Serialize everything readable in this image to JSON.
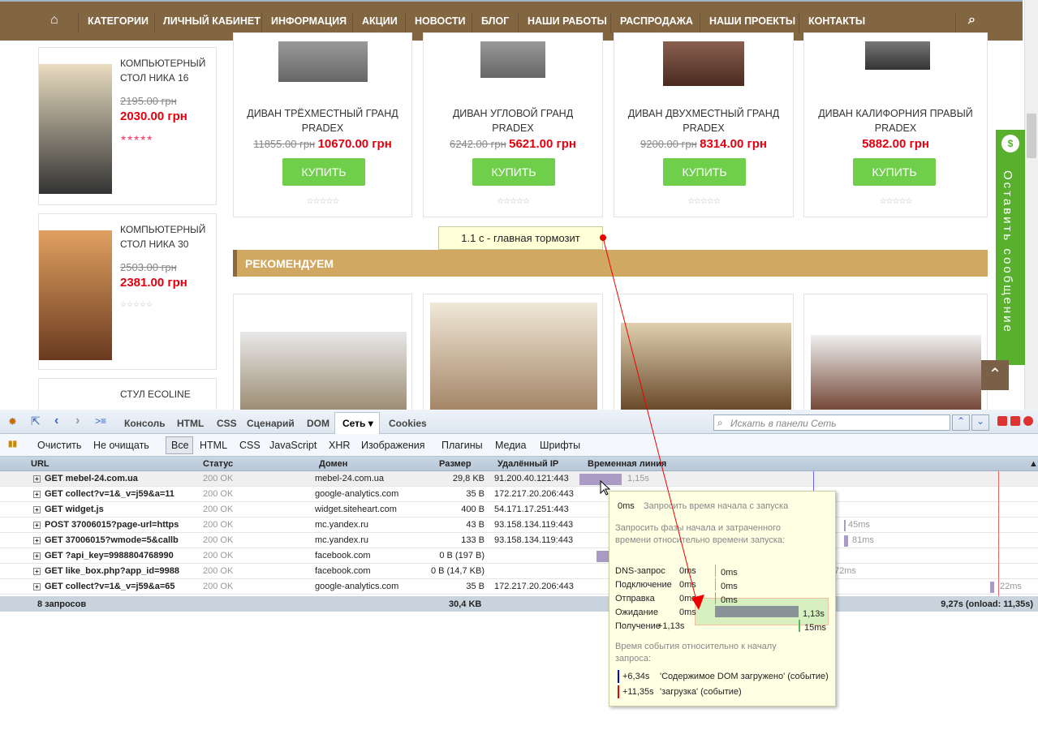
{
  "nav": {
    "items": [
      "Категории",
      "Личный кабинет",
      "Информация",
      "Акции",
      "Новости",
      "Блог",
      "Наши работы",
      "Распродажа",
      "Наши проекты",
      "Контакты"
    ]
  },
  "sidebar": [
    {
      "title": "Компьютерный стол Ника 16",
      "old": "2195.00 грн",
      "new": "2030.00 грн",
      "stars": "★★★★★"
    },
    {
      "title": "Компьютерный стол Ника 30",
      "old": "2503.00 грн",
      "new": "2381.00 грн",
      "stars": "☆☆☆☆☆"
    },
    {
      "title": "Стул Ecoline"
    }
  ],
  "products": [
    {
      "name": "ДИВАН ТРЁХМЕСТНЫЙ ГРАНД PRADEX",
      "old": "11855.00 грн",
      "new": "10670.00 грн"
    },
    {
      "name": "ДИВАН УГЛОВОЙ ГРАНД PRADEX",
      "old": "6242.00 грн",
      "new": "5621.00 грн"
    },
    {
      "name": "ДИВАН ДВУХМЕСТНЫЙ ГРАНД PRADEX",
      "old": "9200.00 грн",
      "new": "8314.00 грн"
    },
    {
      "name": "ДИВАН КАЛИФОРНИЯ ПРАВЫЙ PRADEX",
      "old": "",
      "new": "5882.00 грн"
    }
  ],
  "buy_label": "КУПИТЬ",
  "stars_empty": "☆☆☆☆☆",
  "recommend": "РЕКОМЕНДУЕМ",
  "chat": "Оставить сообщение",
  "annotation": "1.1 с - главная тормозит",
  "devtools": {
    "tabs": [
      "Консоль",
      "HTML",
      "CSS",
      "Сценарий",
      "DOM",
      "Сеть ▾",
      "Cookies"
    ],
    "search_placeholder": "Искать в панели Сеть",
    "actions": [
      "Очистить",
      "Не очищать"
    ],
    "filters": [
      "Все",
      "HTML",
      "CSS",
      "JavaScript",
      "XHR",
      "Изображения",
      "Плагины",
      "Медиа",
      "Шрифты"
    ],
    "columns": [
      "URL",
      "Статус",
      "Домен",
      "Размер",
      "Удалённый IP",
      "Временная линия"
    ],
    "rows": [
      {
        "url": "GET mebel-24.com.ua",
        "status": "200 OK",
        "domain": "mebel-24.com.ua",
        "size": "29,8 KB",
        "ip": "91.200.40.121:443",
        "time": "1,15s"
      },
      {
        "url": "GET collect?v=1&_v=j59&a=11",
        "status": "200 OK",
        "domain": "google-analytics.com",
        "size": "35 B",
        "ip": "172.217.20.206:443",
        "time": ""
      },
      {
        "url": "GET widget.js",
        "status": "200 OK",
        "domain": "widget.siteheart.com",
        "size": "400 B",
        "ip": "54.171.17.251:443",
        "time": ""
      },
      {
        "url": "POST 37006015?page-url=https",
        "status": "200 OK",
        "domain": "mc.yandex.ru",
        "size": "43 B",
        "ip": "93.158.134.119:443",
        "time": "45ms"
      },
      {
        "url": "GET 37006015?wmode=5&callb",
        "status": "200 OK",
        "domain": "mc.yandex.ru",
        "size": "133 B",
        "ip": "93.158.134.119:443",
        "time": "81ms"
      },
      {
        "url": "GET ?api_key=9988804768990",
        "status": "200 OK",
        "domain": "facebook.com",
        "size": "0 B (197 B)",
        "ip": "",
        "time": ""
      },
      {
        "url": "GET like_box.php?app_id=9988",
        "status": "200 OK",
        "domain": "facebook.com",
        "size": "0 B (14,7 KB)",
        "ip": "",
        "time": "72ms"
      },
      {
        "url": "GET collect?v=1&_v=j59&a=65",
        "status": "200 OK",
        "domain": "google-analytics.com",
        "size": "35 B",
        "ip": "172.217.20.206:443",
        "time": "22ms"
      }
    ],
    "summary": {
      "count": "8 запросов",
      "size": "30,4 KB",
      "total": "9,27s (onload: 11,35s)"
    },
    "tooltip": {
      "start_val": "0ms",
      "start_label": "Запросить время начала с запуска",
      "phases_title": "Запросить фазы начала и затраченного времени относительно времени запуска:",
      "phases": [
        {
          "name": "DNS-запрос",
          "start": "0ms",
          "dur": "0ms",
          "color": "#7fb1d0"
        },
        {
          "name": "Подключение",
          "start": "0ms",
          "dur": "0ms",
          "color": "#9bbf4c"
        },
        {
          "name": "Отправка",
          "start": "0ms",
          "dur": "0ms",
          "color": "#c08a78"
        },
        {
          "name": "Ожидание",
          "start": "0ms",
          "dur": "1,13s",
          "color": "#8a9498"
        },
        {
          "name": "Получение",
          "start": "+1,13s",
          "dur": "15ms",
          "color": "#5cb85c"
        }
      ],
      "events_title": "Время события относительно к началу запроса:",
      "events": [
        {
          "time": "+6,34s",
          "label": "'Содержимое DOM загружено' (событие)"
        },
        {
          "time": "+11,35s",
          "label": "'загрузка' (событие)"
        }
      ]
    }
  }
}
